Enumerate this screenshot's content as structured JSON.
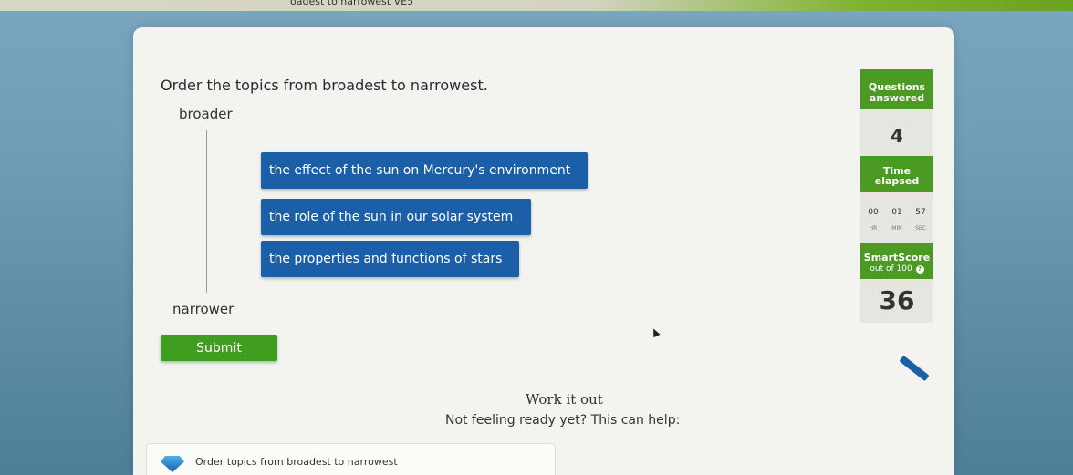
{
  "topbar": {
    "breadcrumb": "oadest to narrowest   VE5"
  },
  "question": {
    "prompt": "Order the topics from broadest to narrowest.",
    "broader_label": "broader",
    "narrower_label": "narrower",
    "tiles": [
      {
        "label": "the effect of the sun on Mercury's environment"
      },
      {
        "label": "the role of the sun in our solar system"
      },
      {
        "label": "the properties and functions of stars"
      }
    ],
    "submit_label": "Submit"
  },
  "sidebar": {
    "questions_label_1": "Questions",
    "questions_label_2": "answered",
    "questions_value": "4",
    "time_label_1": "Time",
    "time_label_2": "elapsed",
    "timer": {
      "hr": "00",
      "min": "01",
      "sec": "57",
      "hr_label": "HR",
      "min_label": "MIN",
      "sec_label": "SEC"
    },
    "score_label": "SmartScore",
    "score_sub": "out of 100",
    "score_value": "36"
  },
  "help": {
    "work_title": "Work it out",
    "text": "Not feeling ready yet? This can help:",
    "lesson_link": "Order topics from broadest to narrowest"
  },
  "colors": {
    "tile_blue": "#1b5fa8",
    "sidebar_green": "#4a9a24",
    "submit_green": "#3f9e1f"
  },
  "icons": {
    "help": "question-icon",
    "lesson": "gem-icon",
    "scratchpad": "pencil-icon"
  }
}
